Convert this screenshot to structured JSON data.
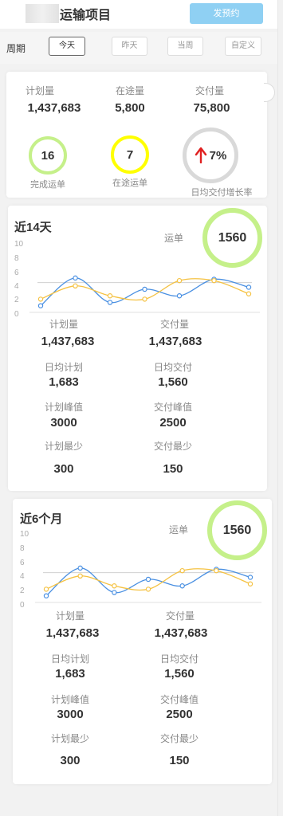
{
  "header": {
    "title": "运输项目",
    "primary_button": "发预约"
  },
  "period": {
    "label": "周期",
    "options": [
      "今天",
      "昨天",
      "当周",
      "自定义"
    ],
    "selected": "今天"
  },
  "summary": {
    "stats": [
      {
        "label": "计划量",
        "value": "1,437,683"
      },
      {
        "label": "在途量",
        "value": "5,800"
      },
      {
        "label": "交付量",
        "value": "75,800"
      }
    ],
    "rings": [
      {
        "value": "16",
        "label": "完成运单",
        "color": "#c5f08a"
      },
      {
        "value": "7",
        "label": "在途运单",
        "color": "#ffff00"
      }
    ],
    "growth": {
      "value": "7%",
      "label": "日均交付增长率",
      "arrow": "up-arrow-icon",
      "arrow_color": "#e02020",
      "ring_color": "#d9d9d9"
    }
  },
  "panels": [
    {
      "title": "近14天",
      "waybill_label": "运单",
      "waybill_value": "1560",
      "ring_color": "#c5f08a",
      "y_ticks": [
        "10",
        "8",
        "6",
        "4",
        "2",
        "0"
      ],
      "metrics": [
        {
          "label": "计划量",
          "value": "1,437,683"
        },
        {
          "label": "交付量",
          "value": "1,437,683"
        },
        {
          "label": "日均计划",
          "value": "1,683"
        },
        {
          "label": "日均交付",
          "value": "1,560"
        },
        {
          "label": "计划峰值",
          "value": "3000"
        },
        {
          "label": "交付峰值",
          "value": "2500"
        },
        {
          "label": "计划最少",
          "value": "300"
        },
        {
          "label": "交付最少",
          "value": "150"
        }
      ]
    },
    {
      "title": "近6个月",
      "waybill_label": "运单",
      "waybill_value": "1560",
      "ring_color": "#c5f08a",
      "y_ticks": [
        "10",
        "8",
        "6",
        "4",
        "2",
        "0"
      ],
      "metrics": [
        {
          "label": "计划量",
          "value": "1,437,683"
        },
        {
          "label": "交付量",
          "value": "1,437,683"
        },
        {
          "label": "日均计划",
          "value": "1,683"
        },
        {
          "label": "日均交付",
          "value": "1,560"
        },
        {
          "label": "计划峰值",
          "value": "3000"
        },
        {
          "label": "交付峰值",
          "value": "2500"
        },
        {
          "label": "计划最少",
          "value": "300"
        },
        {
          "label": "交付最少",
          "value": "150"
        }
      ]
    }
  ],
  "chart_data": [
    {
      "type": "line",
      "ylim": [
        0,
        10
      ],
      "grid": false,
      "reference_line": 4.5,
      "x": [
        1,
        2,
        3,
        4,
        5,
        6,
        7
      ],
      "series": [
        {
          "color": "#4a90e2",
          "values": [
            1.0,
            5.2,
            1.5,
            3.5,
            2.5,
            5.0,
            3.8
          ]
        },
        {
          "color": "#f5c242",
          "values": [
            2.0,
            4.0,
            2.5,
            2.0,
            4.8,
            4.8,
            2.8
          ]
        }
      ]
    },
    {
      "type": "line",
      "ylim": [
        0,
        10
      ],
      "grid": false,
      "reference_line": 4.5,
      "x": [
        1,
        2,
        3,
        4,
        5,
        6,
        7
      ],
      "series": [
        {
          "color": "#4a90e2",
          "values": [
            1.0,
            5.2,
            1.5,
            3.5,
            2.5,
            5.0,
            3.8
          ]
        },
        {
          "color": "#f5c242",
          "values": [
            2.0,
            4.0,
            2.5,
            2.0,
            4.8,
            4.8,
            2.8
          ]
        }
      ]
    }
  ]
}
